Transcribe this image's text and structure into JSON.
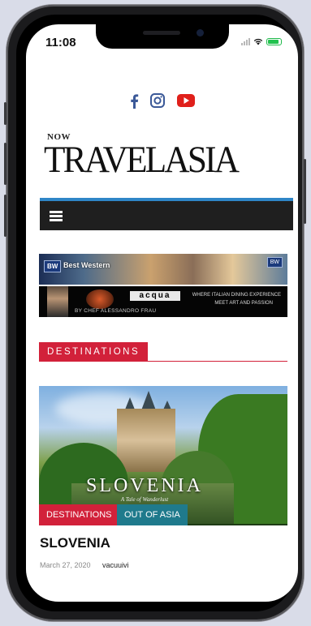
{
  "status": {
    "time": "11:08"
  },
  "social": [
    {
      "name": "facebook",
      "glyph": "f",
      "color": "#3b5998"
    },
    {
      "name": "instagram",
      "color": "#3b5998"
    },
    {
      "name": "youtube",
      "color": "#e0201b"
    }
  ],
  "logo": {
    "prefix": "NOW",
    "main": "TRAVELASIA"
  },
  "ads": {
    "hotel": {
      "brand": "BW",
      "name": "Best Western",
      "right": "BW"
    },
    "restaurant": {
      "brand": "acqua",
      "chef": "BY CHEF ALESSANDRO FRAU",
      "tagline_1": "WHERE ITALIAN DINING EXPERIENCE",
      "tagline_2": "MEET ART AND PASSION"
    }
  },
  "section": {
    "title": "DESTINATIONS"
  },
  "post": {
    "image_title": "SLOVENIA",
    "image_subtitle": "A Tale of Wanderlust",
    "categories": [
      "DESTINATIONS",
      "OUT OF ASIA"
    ],
    "title": "SLOVENIA",
    "date": "March 27, 2020",
    "author": "vacuuivi"
  },
  "colors": {
    "accent": "#d2213a",
    "nav_border": "#2f86c7",
    "category_2": "#1f7a8c"
  }
}
